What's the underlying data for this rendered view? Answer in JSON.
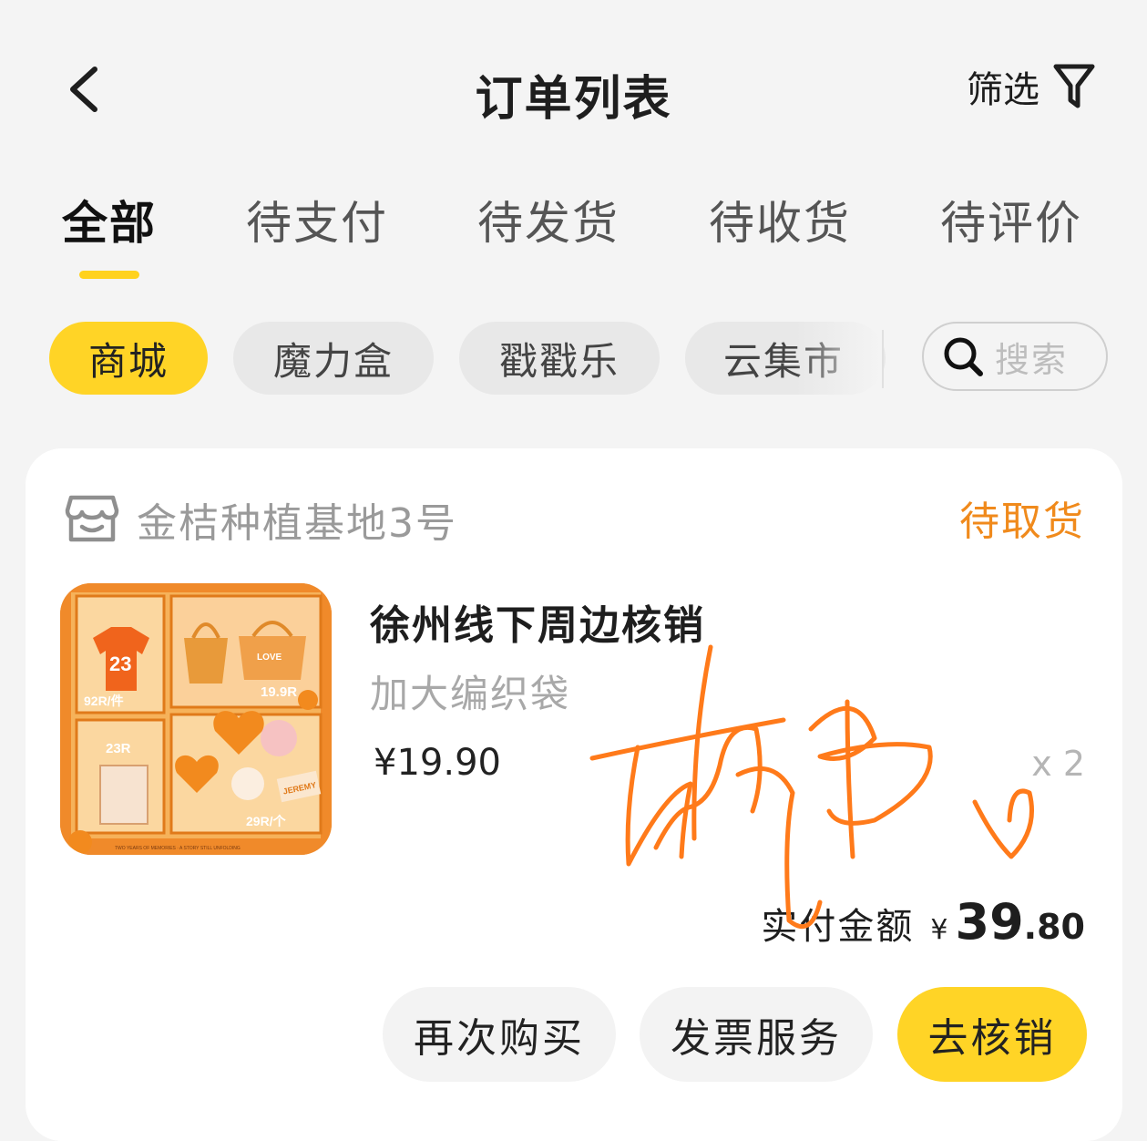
{
  "header": {
    "title": "订单列表",
    "filter_label": "筛选"
  },
  "tabs": [
    {
      "label": "全部",
      "active": true
    },
    {
      "label": "待支付",
      "active": false
    },
    {
      "label": "待发货",
      "active": false
    },
    {
      "label": "待收货",
      "active": false
    },
    {
      "label": "待评价",
      "active": false
    }
  ],
  "chips": [
    {
      "label": "商城",
      "active": true
    },
    {
      "label": "魔力盒",
      "active": false
    },
    {
      "label": "戳戳乐",
      "active": false
    },
    {
      "label": "云集市",
      "active": false
    }
  ],
  "search": {
    "placeholder": "搜索"
  },
  "order": {
    "shop_name": "金桔种植基地3号",
    "status": "待取货",
    "product_name": "徐州线下周边核销",
    "product_spec": "加大编织袋",
    "unit_price": "¥19.90",
    "quantity": "x 2",
    "paid_label": "实付金额",
    "paid_currency": "¥",
    "paid_integer": "39",
    "paid_decimal": ".80",
    "thumbnail_texts": [
      "23",
      "92R/件",
      "LOVE",
      "19.9R",
      "23R",
      "29R/个",
      "JEREMY",
      "TWO YEARS OF MEMORIES · A STORY STILL UNFOLDING"
    ],
    "actions": {
      "buy_again": "再次购买",
      "invoice": "发票服务",
      "verify": "去核销"
    }
  },
  "colors": {
    "accent_yellow": "#ffd426",
    "status_orange": "#f08a1c",
    "background": "#f4f4f4",
    "signature": "#ff7a1a"
  },
  "icons": {
    "back": "chevron-left-icon",
    "filter": "funnel-icon",
    "search": "magnifier-icon",
    "shop": "store-icon"
  }
}
